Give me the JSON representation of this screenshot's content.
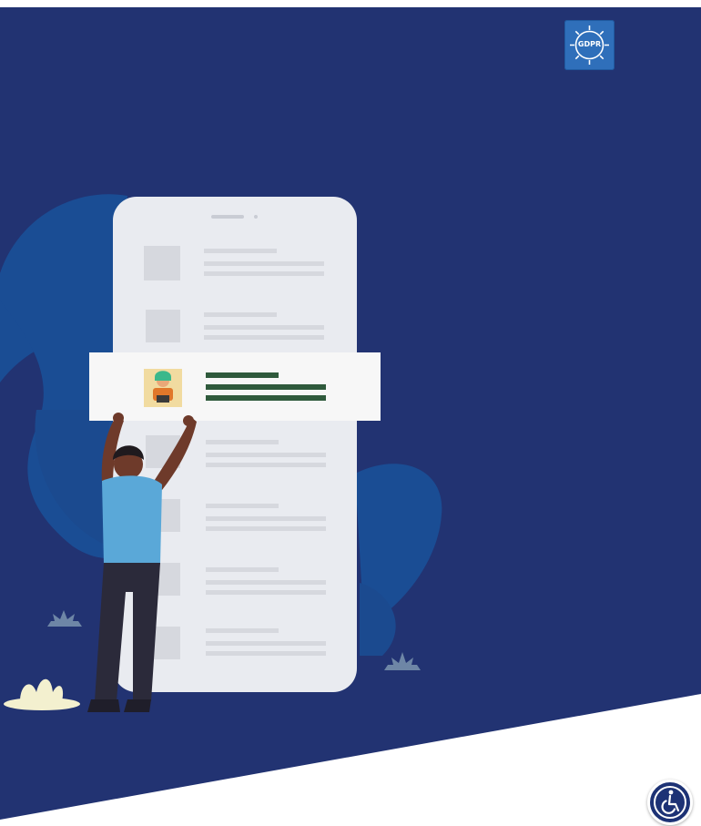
{
  "colors": {
    "background": "#223372",
    "leaf": "#1a4d94",
    "phone": "#e9ebf0",
    "highlight_card": "#f7f7f7",
    "highlight_lines": "#2f5a3c",
    "person_shirt": "#5aa8d8",
    "person_pants": "#2b2a3a",
    "gdpr_badge": "#2f6fba"
  },
  "gdpr_badge": {
    "label": "GDPR",
    "icon": "gear-icon"
  },
  "phone": {
    "rows": [
      {
        "kind": "placeholder"
      },
      {
        "kind": "placeholder"
      },
      {
        "kind": "highlighted",
        "avatar": "person-avatar"
      },
      {
        "kind": "placeholder"
      },
      {
        "kind": "placeholder"
      },
      {
        "kind": "placeholder"
      },
      {
        "kind": "placeholder"
      }
    ]
  },
  "accessibility_button": {
    "icon": "wheelchair-icon"
  }
}
